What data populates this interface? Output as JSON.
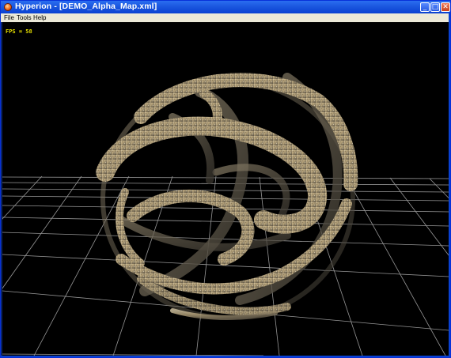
{
  "window": {
    "title": "Hyperion - [DEMO_Alpha_Map.xml]",
    "app_icon": "hyperion-app-icon",
    "controls": {
      "minimize": "_",
      "maximize": "□",
      "close": "✕"
    }
  },
  "menubar": {
    "items": [
      {
        "label": "File"
      },
      {
        "label": "Tools"
      },
      {
        "label": "Help"
      }
    ]
  },
  "viewport": {
    "fps_label": "FPS = 58",
    "background": "#000000",
    "fps_color": "#e7e000",
    "grid_color": "#c8c8c8",
    "object": "alpha-mapped rock-textured sphere"
  }
}
